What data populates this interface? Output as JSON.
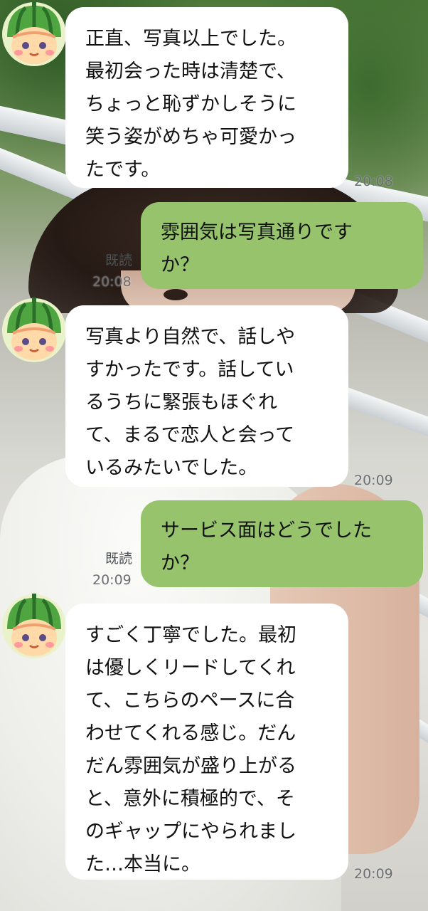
{
  "messages": [
    {
      "side": "incoming",
      "text": "正直、写真以上でした。\n最初会った時は清楚で、\nちょっと恥ずかしそうに\n笑う姿がめちゃ可愛かっ\nたです。",
      "time": "20:08"
    },
    {
      "side": "outgoing",
      "text": "雰囲気は写真通りです\nか？",
      "read": "既読",
      "time": "20:08"
    },
    {
      "side": "incoming",
      "text": "写真より自然で、話しや\nすかったです。話してい\nるうちに緊張もほぐれ\nて、まるで恋人と会って\nいるみたいでした。",
      "time": "20:09"
    },
    {
      "side": "outgoing",
      "text": "サービス面はどうでした\nか？",
      "read": "既読",
      "time": "20:09"
    },
    {
      "side": "incoming",
      "text": "すごく丁寧でした。最初\nは優しくリードしてくれ\nて、こちらのペースに合\nわせてくれる感じ。だん\nだん雰囲気が盛り上がる\nと、意外に積極的で、そ\nのギャップにやられまし\nた…本当に。",
      "time": "20:09"
    }
  ],
  "avatar_icon": "watermelon-kid-icon",
  "colors": {
    "incoming_bubble": "#ffffff",
    "outgoing_bubble": "#97c36c"
  }
}
